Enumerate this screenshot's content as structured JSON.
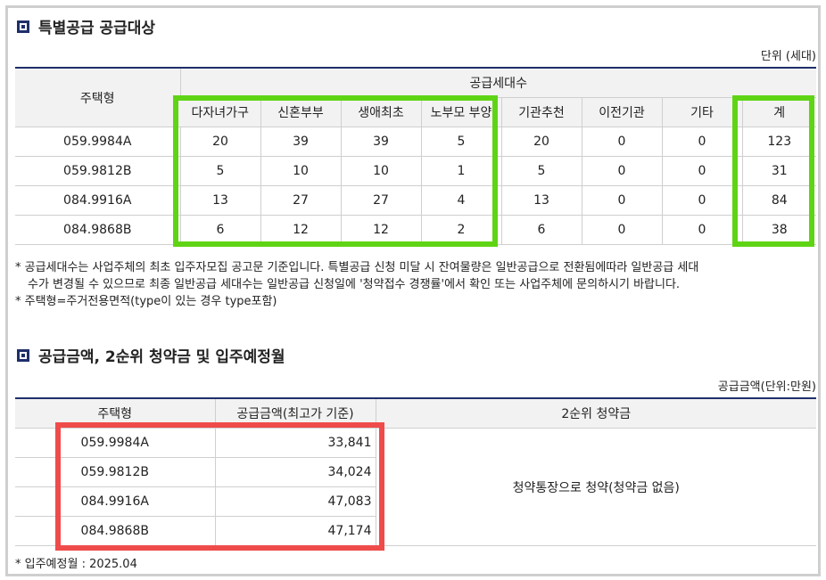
{
  "section1": {
    "title": "특별공급 공급대상",
    "unit": "단위 (세대)",
    "header_type": "주택형",
    "header_group": "공급세대수",
    "columns": [
      "다자녀가구",
      "신혼부부",
      "생애최초",
      "노부모 부양",
      "기관추천",
      "이전기관",
      "기타",
      "계"
    ],
    "rows": [
      {
        "type": "059.9984A",
        "values": [
          "20",
          "39",
          "39",
          "5",
          "20",
          "0",
          "0",
          "123"
        ]
      },
      {
        "type": "059.9812B",
        "values": [
          "5",
          "10",
          "10",
          "1",
          "5",
          "0",
          "0",
          "31"
        ]
      },
      {
        "type": "084.9916A",
        "values": [
          "13",
          "27",
          "27",
          "4",
          "13",
          "0",
          "0",
          "84"
        ]
      },
      {
        "type": "084.9868B",
        "values": [
          "6",
          "12",
          "12",
          "2",
          "6",
          "0",
          "0",
          "38"
        ]
      }
    ],
    "note1_line1": "* 공급세대수는 사업주체의 최초 입주자모집 공고문 기준입니다. 특별공급 신청 미달 시 잔여물량은 일반공급으로 전환됨에따라 일반공급 세대",
    "note1_line2": "수가 변경될 수 있으므로 최종 일반공급 세대수는 일반공급 신청일에 '청약접수 경쟁률'에서 확인 또는 사업주체에 문의하시기 바랍니다.",
    "note2": "* 주택형=주거전용면적(type이 있는 경우 type포함)"
  },
  "section2": {
    "title": "공급금액, 2순위 청약금 및 입주예정월",
    "unit": "공급금액(단위:만원)",
    "header_type": "주택형",
    "header_amount": "공급금액(최고가 기준)",
    "header_deposit": "2순위 청약금",
    "rows": [
      {
        "type": "059.9984A",
        "amount": "33,841"
      },
      {
        "type": "059.9812B",
        "amount": "34,024"
      },
      {
        "type": "084.9916A",
        "amount": "47,083"
      },
      {
        "type": "084.9868B",
        "amount": "47,174"
      }
    ],
    "deposit_text": "청약통장으로 청약(청약금 없음)",
    "move_in": "* 입주예정월 : 2025.04"
  },
  "colors": {
    "accent_navy": "#1f2f6a",
    "highlight_green": "#5fd414",
    "highlight_red": "#ef4b4b"
  }
}
